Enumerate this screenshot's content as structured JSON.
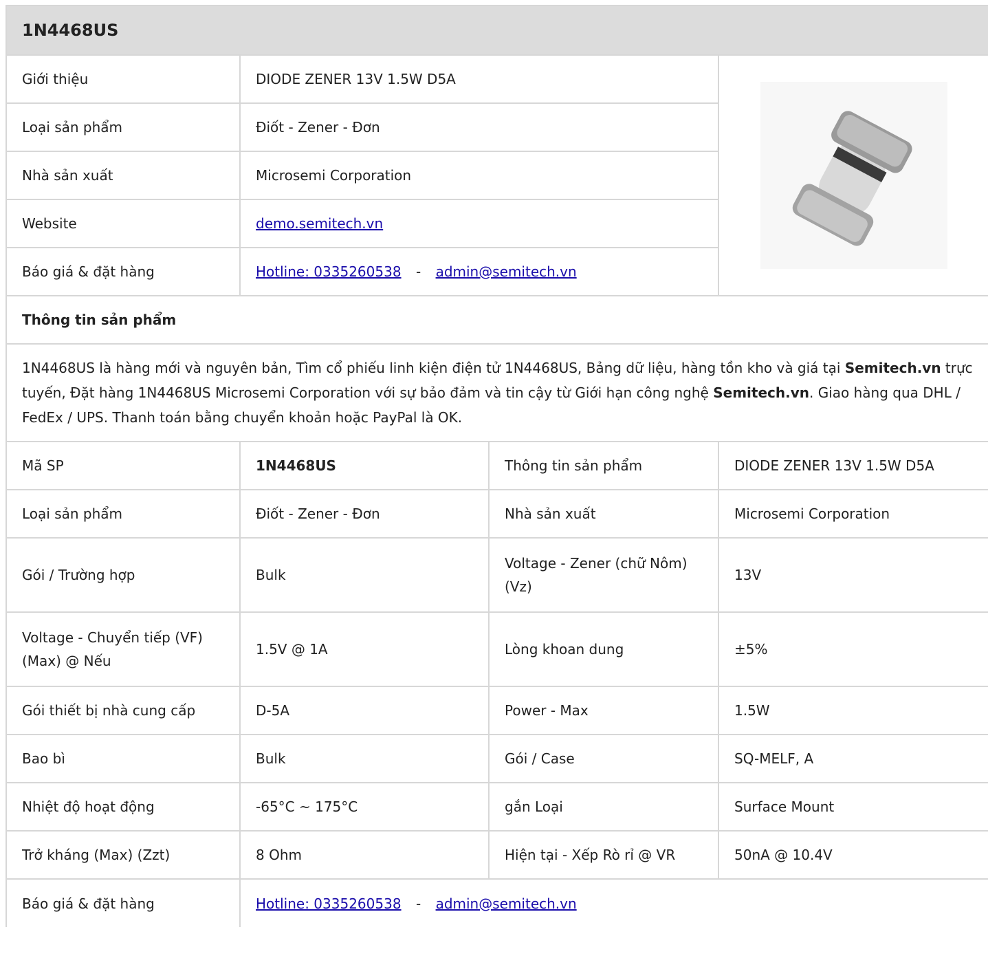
{
  "title": "1N4468US",
  "overview": {
    "rows": [
      {
        "label": "Giới thiệu",
        "value": "DIODE ZENER 13V 1.5W D5A"
      },
      {
        "label": "Loại sản phẩm",
        "value": "Điốt - Zener - Đơn"
      },
      {
        "label": "Nhà sản xuất",
        "value": "Microsemi Corporation"
      },
      {
        "label": "Website",
        "value": "demo.semitech.vn"
      },
      {
        "label": "Báo giá & đặt hàng",
        "hotline": "Hotline: 0335260538",
        "separator": "-",
        "email": "admin@semitech.vn"
      }
    ],
    "image_alt": "1N4468US diode SQ-MELF package"
  },
  "info_heading": "Thông tin sản phẩm",
  "description": {
    "part1": "1N4468US là hàng mới và nguyên bản, Tìm cổ phiếu linh kiện điện tử 1N4468US, Bảng dữ liệu, hàng tồn kho và giá tại ",
    "brand1": "Semitech.vn",
    "part2": " trực tuyến, Đặt hàng 1N4468US Microsemi Corporation với sự bảo đảm và tin cậy từ Giới hạn công nghệ ",
    "brand2": "Semitech.vn",
    "part3": ". Giao hàng qua DHL / FedEx / UPS. Thanh toán bằng chuyển khoản hoặc PayPal là OK."
  },
  "specs": [
    {
      "l1": "Mã SP",
      "v1": "1N4468US",
      "l2": "Thông tin sản phẩm",
      "v2": "DIODE ZENER 13V 1.5W D5A"
    },
    {
      "l1": "Loại sản phẩm",
      "v1": "Điốt - Zener - Đơn",
      "l2": "Nhà sản xuất",
      "v2": "Microsemi Corporation"
    },
    {
      "l1": "Gói / Trường hợp",
      "v1": "Bulk",
      "l2": "Voltage - Zener (chữ Nôm) (Vz)",
      "v2": "13V"
    },
    {
      "l1": "Voltage - Chuyển tiếp (VF) (Max) @ Nếu",
      "v1": "1.5V @ 1A",
      "l2": "Lòng khoan dung",
      "v2": "±5%"
    },
    {
      "l1": "Gói thiết bị nhà cung cấp",
      "v1": "D-5A",
      "l2": "Power - Max",
      "v2": "1.5W"
    },
    {
      "l1": "Bao bì",
      "v1": "Bulk",
      "l2": "Gói / Case",
      "v2": "SQ-MELF, A"
    },
    {
      "l1": "Nhiệt độ hoạt động",
      "v1": "-65°C ~ 175°C",
      "l2": "gắn Loại",
      "v2": "Surface Mount"
    },
    {
      "l1": "Trở kháng (Max) (Zzt)",
      "v1": "8 Ohm",
      "l2": "Hiện tại - Xếp Rò rỉ @ VR",
      "v2": "50nA @ 10.4V"
    }
  ],
  "order": {
    "label": "Báo giá & đặt hàng",
    "hotline": "Hotline: 0335260538",
    "separator": "-",
    "email": "admin@semitech.vn"
  }
}
